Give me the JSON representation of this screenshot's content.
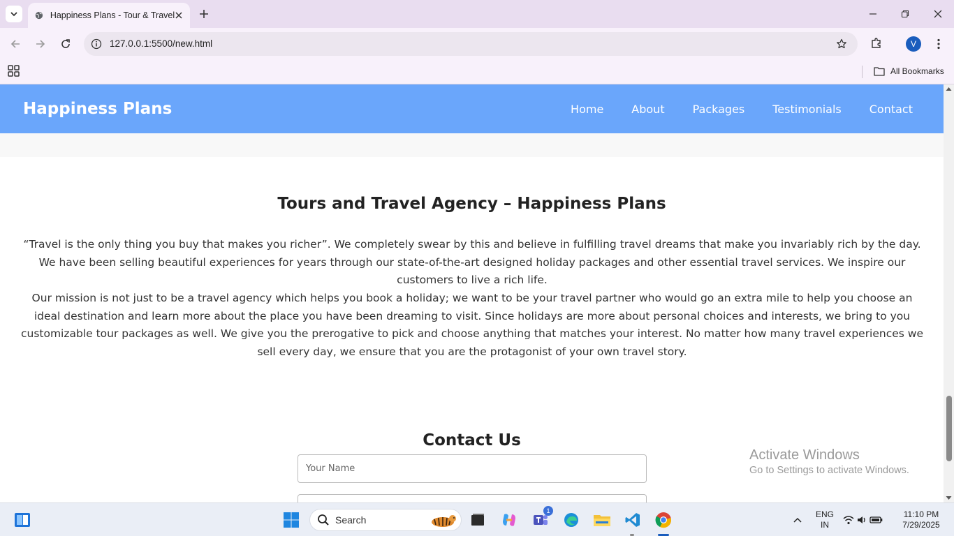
{
  "browser": {
    "tab_title": "Happiness Plans - Tour & Travel",
    "url": "127.0.0.1:5500/new.html",
    "profile_initial": "V",
    "all_bookmarks": "All Bookmarks"
  },
  "site": {
    "brand": "Happiness Plans",
    "nav": [
      "Home",
      "About",
      "Packages",
      "Testimonials",
      "Contact"
    ],
    "about_title": "Tours and Travel Agency – Happiness Plans",
    "about_p1": "“Travel is the only thing you buy that makes you richer”. We completely swear by this and believe in fulfilling travel dreams that make you invariably rich by the day. We have been selling beautiful experiences for years through our state-of-the-art designed holiday packages and other essential travel services. We inspire our customers to live a rich life.",
    "about_p2": "Our mission is not just to be a travel agency which helps you book a holiday; we want to be your travel partner who would go an extra mile to help you choose an ideal destination and learn more about the place you have been dreaming to visit. Since holidays are more about personal choices and interests, we bring to you customizable tour packages as well. We give you the prerogative to pick and choose anything that matches your interest. No matter how many travel experiences we sell every day, we ensure that you are the protagonist of your own travel story.",
    "contact_title": "Contact Us",
    "name_placeholder": "Your Name"
  },
  "watermark": {
    "line1": "Activate Windows",
    "line2": "Go to Settings to activate Windows."
  },
  "taskbar": {
    "search_label": "Search",
    "teams_badge": "1",
    "lang_line1": "ENG",
    "lang_line2": "IN",
    "time": "11:10 PM",
    "date": "7/29/2025"
  },
  "colors": {
    "header_bg": "#6aa6fb",
    "tabbar_bg": "#e9ddf0",
    "toolbar_bg": "#f8f1fb"
  }
}
